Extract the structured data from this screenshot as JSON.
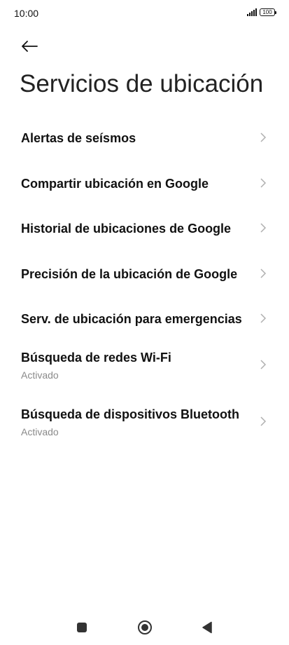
{
  "status_bar": {
    "time": "10:00",
    "battery": "100",
    "icons": [
      "signal-icon",
      "battery-icon"
    ]
  },
  "header": {
    "back_icon": "back-arrow-icon",
    "title": "Servicios de ubicación"
  },
  "items": [
    {
      "title": "Alertas de seísmos",
      "subtitle": ""
    },
    {
      "title": "Compartir ubicación en Google",
      "subtitle": ""
    },
    {
      "title": "Historial de ubicaciones de Google",
      "subtitle": ""
    },
    {
      "title": "Precisión de la ubicación de Google",
      "subtitle": ""
    },
    {
      "title": "Serv. de ubicación para emergencias",
      "subtitle": ""
    },
    {
      "title": "Búsqueda de redes Wi-Fi",
      "subtitle": "Activado"
    },
    {
      "title": "Búsqueda de dispositivos Bluetooth",
      "subtitle": "Activado"
    }
  ],
  "nav_bar": {
    "icons": [
      "recents-square-icon",
      "home-circle-icon",
      "back-triangle-icon"
    ]
  },
  "colors": {
    "background": "#ffffff",
    "text_primary": "#111111",
    "text_secondary": "#8a8a8a",
    "chevron": "#b0b0b0"
  }
}
